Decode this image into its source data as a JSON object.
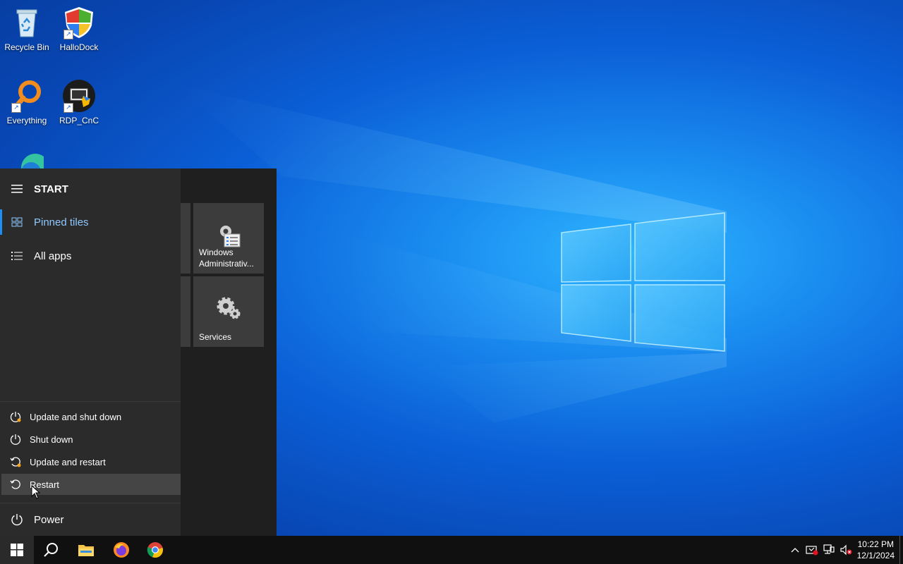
{
  "desktop": {
    "icons": [
      {
        "label": "Recycle Bin",
        "icon": "recycle-bin-icon"
      },
      {
        "label": "HalloDock",
        "icon": "shield-icon"
      },
      {
        "label": "Everything",
        "icon": "search-magnifier-icon"
      },
      {
        "label": "RDP_CnC",
        "icon": "remote-desktop-icon"
      },
      {
        "label": "",
        "icon": "edge-icon"
      }
    ]
  },
  "start_menu": {
    "title": "START",
    "nav": [
      {
        "label": "Pinned tiles",
        "icon": "tiles-icon",
        "active": true
      },
      {
        "label": "All apps",
        "icon": "list-icon",
        "active": false
      }
    ],
    "tiles": [
      {
        "label": "Windows Administrativ...",
        "icon": "admin-tools-icon"
      },
      {
        "label": "Services",
        "icon": "gears-icon"
      }
    ],
    "power_options": [
      {
        "label": "Update and shut down",
        "icon": "update-shutdown-icon"
      },
      {
        "label": "Shut down",
        "icon": "power-icon"
      },
      {
        "label": "Update and restart",
        "icon": "update-restart-icon"
      },
      {
        "label": "Restart",
        "icon": "restart-icon",
        "hovered": true
      }
    ],
    "power_label": "Power"
  },
  "taskbar": {
    "apps": [
      {
        "name": "start",
        "icon": "windows-logo-icon"
      },
      {
        "name": "search",
        "icon": "search-icon"
      },
      {
        "name": "file-explorer",
        "icon": "folder-icon"
      },
      {
        "name": "firefox",
        "icon": "firefox-icon"
      },
      {
        "name": "chrome",
        "icon": "chrome-icon"
      }
    ],
    "clock": {
      "time": "10:22 PM",
      "date": "12/1/2024"
    },
    "accent_color": "#1e8ef5"
  }
}
